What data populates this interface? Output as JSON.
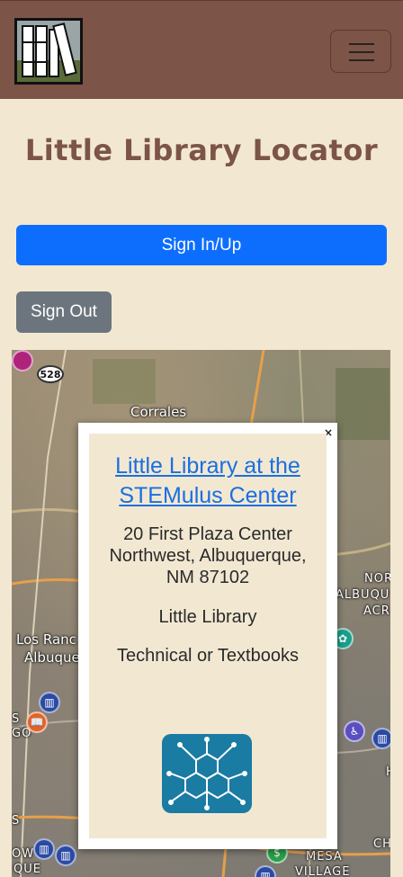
{
  "navbar": {
    "logo_icon": "book-stack-logo",
    "menu_icon": "hamburger-menu-icon",
    "background": "#7c5448"
  },
  "page": {
    "title": "Little Library Locator"
  },
  "auth": {
    "sign_in_label": "Sign In/Up",
    "sign_out_label": "Sign Out"
  },
  "map": {
    "highway_shield": "528",
    "labels": [
      "Corrales",
      "Los Ranc",
      "Albuque",
      "NOR",
      "ALBUQU",
      "ACR",
      "MESA",
      "VILLAGE",
      "S",
      "GO",
      "S",
      "OW",
      "QUE",
      "H",
      "CH"
    ],
    "popup": {
      "close_label": "×",
      "title": "Little Library at the STEMulus Center",
      "address": "20 First Plaza Center Northwest, Albuquerque, NM 87102",
      "type": "Little Library",
      "category": "Technical or Textbooks",
      "image_icon": "stemulus-hexagon-logo"
    }
  }
}
